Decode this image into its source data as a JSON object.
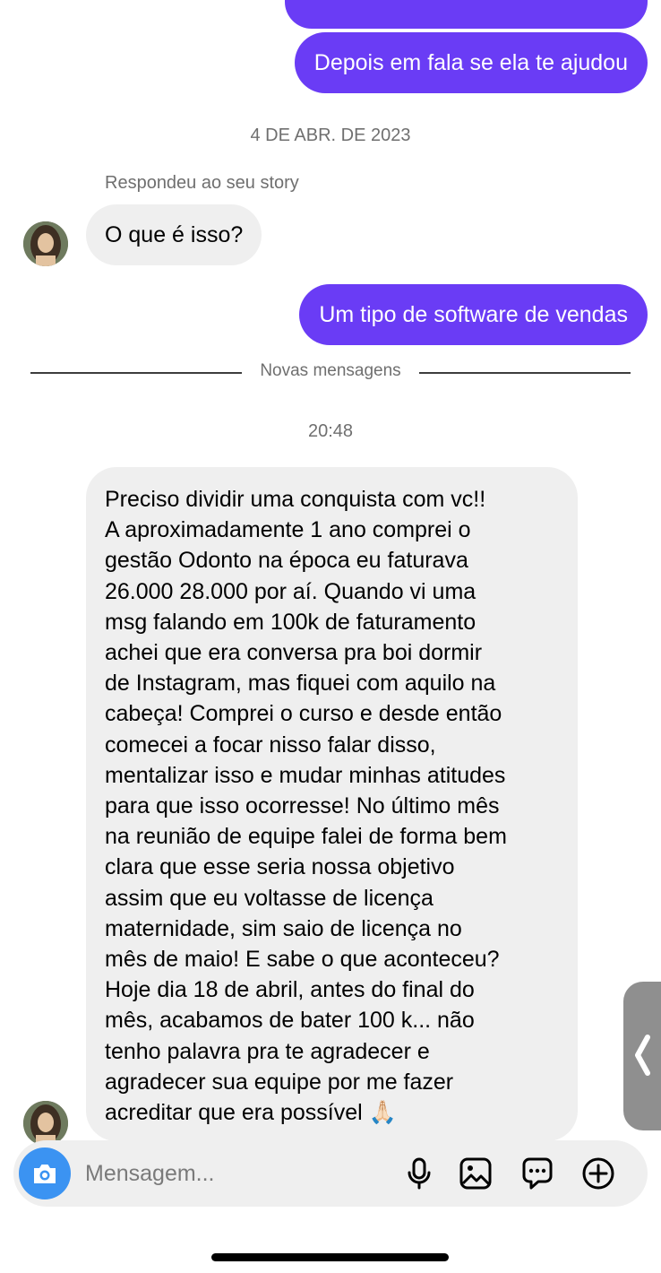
{
  "thread": {
    "sent_messages": [
      "Depois em fala se ela te ajudou",
      "Um tipo de software de vendas"
    ],
    "date_separator": "4 DE ABR. DE 2023",
    "story_reply_note": "Respondeu ao seu story",
    "received_short": "O que é isso?",
    "new_messages_label": "Novas mensagens",
    "time_separator": "20:48",
    "received_long_lines": [
      "Preciso dividir uma conquista com vc!!",
      "A aproximadamente 1 ano comprei o",
      "gestão Odonto na época eu faturava",
      "26.000 28.000 por aí. Quando vi uma",
      "msg falando em 100k de faturamento",
      "achei que era conversa pra boi dormir",
      "de Instagram, mas fiquei com aquilo na",
      "cabeça! Comprei o curso e desde então",
      "comecei a focar nisso falar disso,",
      "mentalizar isso e mudar minhas atitudes",
      "para que isso ocorresse! No último mês",
      "na reunião de equipe falei de forma bem",
      "clara que esse seria nossa objetivo",
      "assim que eu voltasse de licença",
      "maternidade, sim saio de licença no",
      "mês de maio! E sabe o que aconteceu?",
      "Hoje dia 18 de abril,  antes do final do",
      "mês, acabamos de bater 100 k... não",
      "tenho palavra pra te agradecer e",
      "agradecer sua equipe por me fazer",
      "acreditar que era possível 🙏🏻"
    ]
  },
  "composer": {
    "placeholder": "Mensagem...",
    "icons": [
      "camera-icon",
      "microphone-icon",
      "gallery-icon",
      "sticker-icon",
      "plus-icon"
    ]
  },
  "side_tab": {
    "icon": "chevron-left-icon"
  },
  "colors": {
    "sent_bubble": "#6a3cf5",
    "received_bubble": "#efefef",
    "camera_button": "#3b93f2",
    "meta_text": "#6f6f6f"
  }
}
